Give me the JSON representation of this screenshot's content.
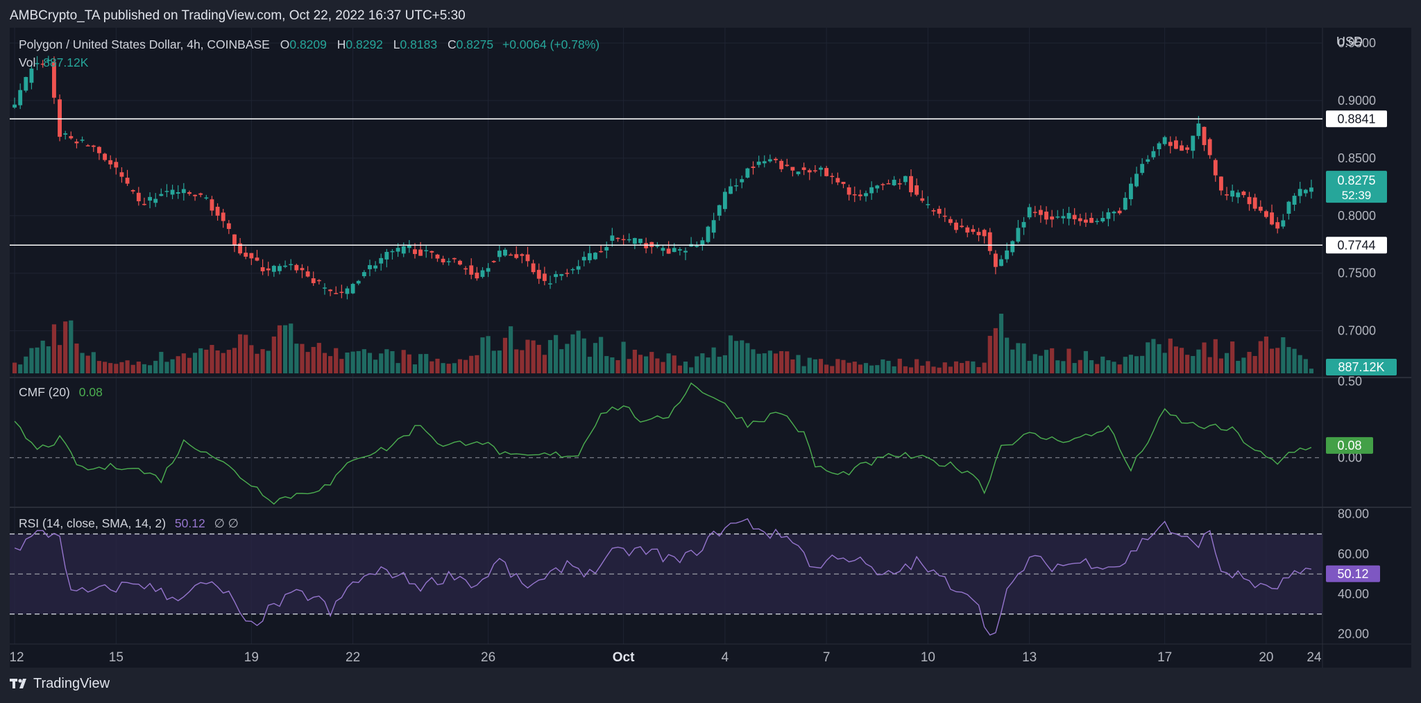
{
  "header": {
    "publisher_line": "AMBCrypto_TA published on TradingView.com, Oct 22, 2022 16:37 UTC+5:30"
  },
  "legend": {
    "symbol": "Polygon / United States Dollar, 4h, COINBASE",
    "o_label": "O",
    "o_value": "0.8209",
    "h_label": "H",
    "h_value": "0.8292",
    "l_label": "L",
    "l_value": "0.8183",
    "c_label": "C",
    "c_value": "0.8275",
    "change": "+0.0064 (+0.78%)",
    "vol_label": "Vol",
    "vol_value": "887.12K"
  },
  "cmf_legend": {
    "label": "CMF (20)",
    "value": "0.08"
  },
  "rsi_legend": {
    "label": "RSI (14, close, SMA, 14, 2)",
    "value": "50.12",
    "extra": "∅  ∅"
  },
  "footer": {
    "brand": "TradingView"
  },
  "colors": {
    "up": "#26a69a",
    "down": "#ef5350",
    "vol_up": "#1f6b62",
    "vol_down": "#8c2f32",
    "cmf": "#4caf50",
    "rsi": "#9575cd",
    "rsi_band": "#2a2545"
  },
  "chart_data": [
    {
      "type": "candlestick",
      "title": "Polygon / United States Dollar, 4h, COINBASE",
      "currency": "USD",
      "x_ticks": [
        "12",
        "15",
        "19",
        "22",
        "26",
        "Oct",
        "4",
        "7",
        "10",
        "13",
        "17",
        "20",
        "24"
      ],
      "y_ticks": [
        "0.9500",
        "0.9000",
        "0.8500",
        "0.8000",
        "0.7500",
        "0.7000"
      ],
      "y_range": [
        0.66,
        0.95
      ],
      "horizontal_lines": [
        {
          "label": "0.8841",
          "value": 0.8841
        },
        {
          "label": "0.7744",
          "value": 0.7744
        }
      ],
      "last_price_label": {
        "price": "0.8275",
        "countdown": "52:39"
      },
      "volume_label": "887.12K",
      "close_path": [
        [
          0,
          0.895
        ],
        [
          3,
          0.93
        ],
        [
          6,
          0.935
        ],
        [
          8,
          0.87
        ],
        [
          14,
          0.86
        ],
        [
          18,
          0.84
        ],
        [
          22,
          0.81
        ],
        [
          28,
          0.822
        ],
        [
          34,
          0.815
        ],
        [
          40,
          0.77
        ],
        [
          44,
          0.754
        ],
        [
          50,
          0.755
        ],
        [
          54,
          0.74
        ],
        [
          58,
          0.73
        ],
        [
          62,
          0.752
        ],
        [
          66,
          0.766
        ],
        [
          70,
          0.772
        ],
        [
          74,
          0.765
        ],
        [
          78,
          0.76
        ],
        [
          82,
          0.748
        ],
        [
          86,
          0.768
        ],
        [
          90,
          0.765
        ],
        [
          94,
          0.742
        ],
        [
          98,
          0.753
        ],
        [
          102,
          0.765
        ],
        [
          106,
          0.78
        ],
        [
          110,
          0.778
        ],
        [
          114,
          0.772
        ],
        [
          118,
          0.768
        ],
        [
          122,
          0.778
        ],
        [
          126,
          0.818
        ],
        [
          130,
          0.84
        ],
        [
          134,
          0.848
        ],
        [
          138,
          0.838
        ],
        [
          142,
          0.842
        ],
        [
          146,
          0.828
        ],
        [
          150,
          0.815
        ],
        [
          154,
          0.828
        ],
        [
          158,
          0.832
        ],
        [
          160,
          0.815
        ],
        [
          164,
          0.8
        ],
        [
          168,
          0.788
        ],
        [
          172,
          0.785
        ],
        [
          174,
          0.755
        ],
        [
          176,
          0.77
        ],
        [
          180,
          0.805
        ],
        [
          184,
          0.798
        ],
        [
          188,
          0.8
        ],
        [
          192,
          0.795
        ],
        [
          196,
          0.805
        ],
        [
          200,
          0.845
        ],
        [
          204,
          0.865
        ],
        [
          208,
          0.858
        ],
        [
          210,
          0.878
        ],
        [
          214,
          0.82
        ],
        [
          218,
          0.818
        ],
        [
          222,
          0.8
        ],
        [
          224,
          0.788
        ],
        [
          226,
          0.81
        ],
        [
          228,
          0.82
        ],
        [
          230,
          0.8275
        ]
      ],
      "volume_path": [
        [
          0,
          0.08
        ],
        [
          5,
          0.3
        ],
        [
          9,
          0.55
        ],
        [
          12,
          0.18
        ],
        [
          20,
          0.1
        ],
        [
          40,
          0.3
        ],
        [
          52,
          0.4
        ],
        [
          58,
          0.15
        ],
        [
          66,
          0.2
        ],
        [
          78,
          0.1
        ],
        [
          86,
          0.35
        ],
        [
          100,
          0.32
        ],
        [
          120,
          0.1
        ],
        [
          124,
          0.32
        ],
        [
          140,
          0.12
        ],
        [
          172,
          0.1
        ],
        [
          174,
          0.62
        ],
        [
          180,
          0.2
        ],
        [
          198,
          0.15
        ],
        [
          204,
          0.3
        ],
        [
          212,
          0.28
        ],
        [
          218,
          0.22
        ],
        [
          224,
          0.32
        ],
        [
          230,
          0.06
        ]
      ]
    },
    {
      "type": "line",
      "title": "CMF (20)",
      "y_ticks": [
        "0.50",
        "0.00"
      ],
      "y_range": [
        -0.32,
        0.52
      ],
      "last_value": 0.08,
      "series": [
        {
          "values_path": [
            [
              0,
              0.22
            ],
            [
              4,
              0.05
            ],
            [
              8,
              0.12
            ],
            [
              12,
              -0.08
            ],
            [
              20,
              -0.05
            ],
            [
              26,
              -0.14
            ],
            [
              30,
              0.1
            ],
            [
              34,
              0.05
            ],
            [
              40,
              -0.12
            ],
            [
              46,
              -0.28
            ],
            [
              52,
              -0.22
            ],
            [
              56,
              -0.18
            ],
            [
              60,
              0.0
            ],
            [
              66,
              0.06
            ],
            [
              72,
              0.22
            ],
            [
              76,
              0.07
            ],
            [
              82,
              0.12
            ],
            [
              88,
              0.0
            ],
            [
              96,
              0.02
            ],
            [
              100,
              0.02
            ],
            [
              104,
              0.3
            ],
            [
              108,
              0.34
            ],
            [
              112,
              0.22
            ],
            [
              116,
              0.28
            ],
            [
              120,
              0.48
            ],
            [
              124,
              0.4
            ],
            [
              130,
              0.22
            ],
            [
              136,
              0.3
            ],
            [
              140,
              0.15
            ],
            [
              142,
              -0.05
            ],
            [
              146,
              -0.12
            ],
            [
              150,
              -0.06
            ],
            [
              156,
              0.02
            ],
            [
              160,
              0.0
            ],
            [
              166,
              -0.05
            ],
            [
              170,
              -0.1
            ],
            [
              172,
              -0.22
            ],
            [
              175,
              0.08
            ],
            [
              180,
              0.15
            ],
            [
              184,
              0.12
            ],
            [
              188,
              0.12
            ],
            [
              192,
              0.16
            ],
            [
              194,
              0.22
            ],
            [
              196,
              0.05
            ],
            [
              198,
              -0.08
            ],
            [
              200,
              0.05
            ],
            [
              204,
              0.3
            ],
            [
              208,
              0.22
            ],
            [
              212,
              0.2
            ],
            [
              216,
              0.18
            ],
            [
              220,
              0.05
            ],
            [
              224,
              -0.05
            ],
            [
              226,
              0.03
            ],
            [
              230,
              0.08
            ]
          ]
        }
      ]
    },
    {
      "type": "line",
      "title": "RSI (14, close, SMA, 14, 2)",
      "y_ticks": [
        "80.00",
        "60.00",
        "40.00",
        "20.00"
      ],
      "y_range": [
        15,
        83
      ],
      "band": [
        30,
        70
      ],
      "midline": 50,
      "last_value": 50.12,
      "series": [
        {
          "values_path": [
            [
              0,
              62
            ],
            [
              4,
              70
            ],
            [
              8,
              70
            ],
            [
              10,
              40
            ],
            [
              16,
              42
            ],
            [
              22,
              46
            ],
            [
              28,
              38
            ],
            [
              34,
              45
            ],
            [
              38,
              40
            ],
            [
              40,
              28
            ],
            [
              42,
              24
            ],
            [
              46,
              34
            ],
            [
              50,
              40
            ],
            [
              54,
              38
            ],
            [
              56,
              30
            ],
            [
              60,
              46
            ],
            [
              66,
              52
            ],
            [
              72,
              44
            ],
            [
              78,
              50
            ],
            [
              82,
              44
            ],
            [
              86,
              57
            ],
            [
              90,
              44
            ],
            [
              94,
              46
            ],
            [
              98,
              56
            ],
            [
              102,
              50
            ],
            [
              106,
              60
            ],
            [
              110,
              62
            ],
            [
              114,
              60
            ],
            [
              118,
              56
            ],
            [
              122,
              64
            ],
            [
              126,
              74
            ],
            [
              130,
              76
            ],
            [
              134,
              70
            ],
            [
              138,
              68
            ],
            [
              142,
              52
            ],
            [
              146,
              60
            ],
            [
              150,
              56
            ],
            [
              154,
              48
            ],
            [
              160,
              56
            ],
            [
              164,
              48
            ],
            [
              168,
              42
            ],
            [
              170,
              40
            ],
            [
              172,
              25
            ],
            [
              174,
              20
            ],
            [
              176,
              40
            ],
            [
              180,
              58
            ],
            [
              184,
              54
            ],
            [
              190,
              56
            ],
            [
              196,
              54
            ],
            [
              200,
              66
            ],
            [
              204,
              76
            ],
            [
              206,
              68
            ],
            [
              210,
              66
            ],
            [
              212,
              70
            ],
            [
              214,
              52
            ],
            [
              218,
              48
            ],
            [
              222,
              42
            ],
            [
              224,
              44
            ],
            [
              226,
              48
            ],
            [
              228,
              50
            ],
            [
              230,
              50.12
            ]
          ]
        }
      ]
    }
  ]
}
